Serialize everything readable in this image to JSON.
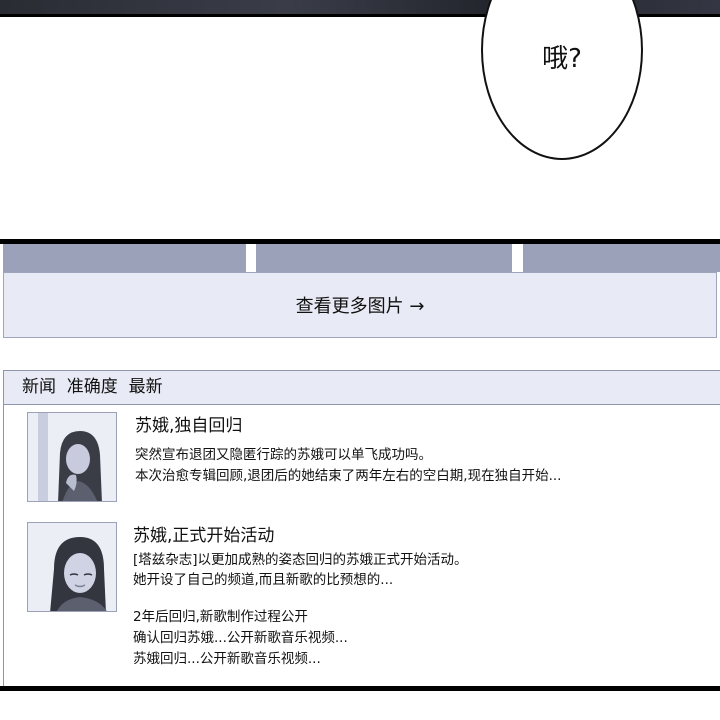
{
  "bubble": {
    "text": "哦?"
  },
  "gallery": {
    "more_label": "查看更多图片 →"
  },
  "news": {
    "header": "新闻  准确度  最新",
    "items": [
      {
        "title": "苏娥,独自回归",
        "lines": [
          "突然宣布退团又隐匿行踪的苏娥可以单飞成功吗。",
          "本次治愈专辑回顾,退团后的她结束了两年左右的空白期,现在独自开始..."
        ]
      },
      {
        "title": "苏娥,正式开始活动",
        "lines": [
          "[塔兹杂志]以更加成熟的姿态回归的苏娥正式开始活动。",
          "她开设了自己的频道,而且新歌的比预想的..."
        ],
        "related": [
          "2年后回归,新歌制作过程公开",
          "确认回归苏娥...公开新歌音乐视频...",
          "苏娥回归...公开新歌音乐视频..."
        ]
      }
    ]
  }
}
